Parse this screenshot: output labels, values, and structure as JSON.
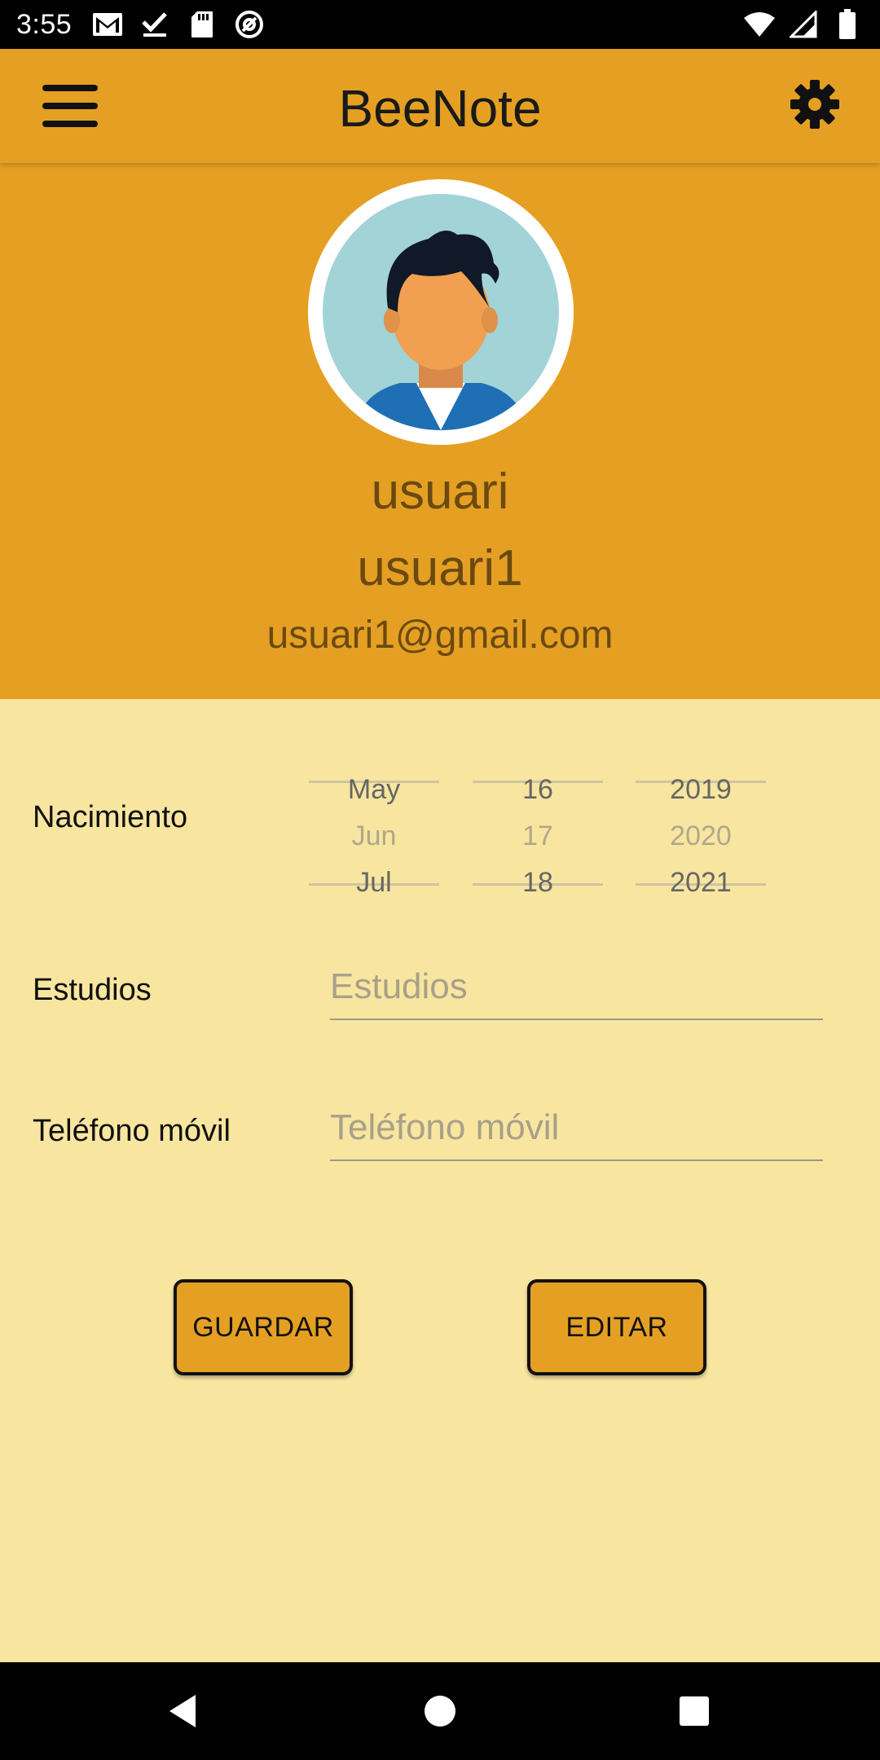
{
  "status_bar": {
    "time": "3:55",
    "left_icons": [
      "gmail-icon",
      "task-check-icon",
      "sd-card-icon",
      "vpn-icon"
    ],
    "right_icons": [
      "wifi-icon",
      "cell-signal-icon",
      "battery-icon"
    ]
  },
  "app_bar": {
    "title": "BeeNote",
    "menu_icon": "hamburger-menu-icon",
    "settings_icon": "gear-icon"
  },
  "profile": {
    "avatar_icon": "user-avatar-icon",
    "name": "usuari",
    "username": "usuari1",
    "email": "usuari1@gmail.com"
  },
  "form": {
    "birth": {
      "label": "Nacimiento",
      "months": [
        "May",
        "Jun",
        "Jul"
      ],
      "days": [
        "16",
        "17",
        "18"
      ],
      "years": [
        "2019",
        "2020",
        "2021"
      ]
    },
    "studies": {
      "label": "Estudios",
      "value": "",
      "placeholder": "Estudios"
    },
    "phone": {
      "label": "Teléfono móvil",
      "value": "",
      "placeholder": "Teléfono móvil"
    }
  },
  "buttons": {
    "save": "GUARDAR",
    "edit": "EDITAR"
  },
  "colors": {
    "accent": "#e5a023",
    "background": "#f8e6a0",
    "text_brown": "#6b4a10"
  },
  "nav_bar": {
    "back_icon": "back-triangle-icon",
    "home_icon": "home-circle-icon",
    "recents_icon": "recents-square-icon"
  }
}
